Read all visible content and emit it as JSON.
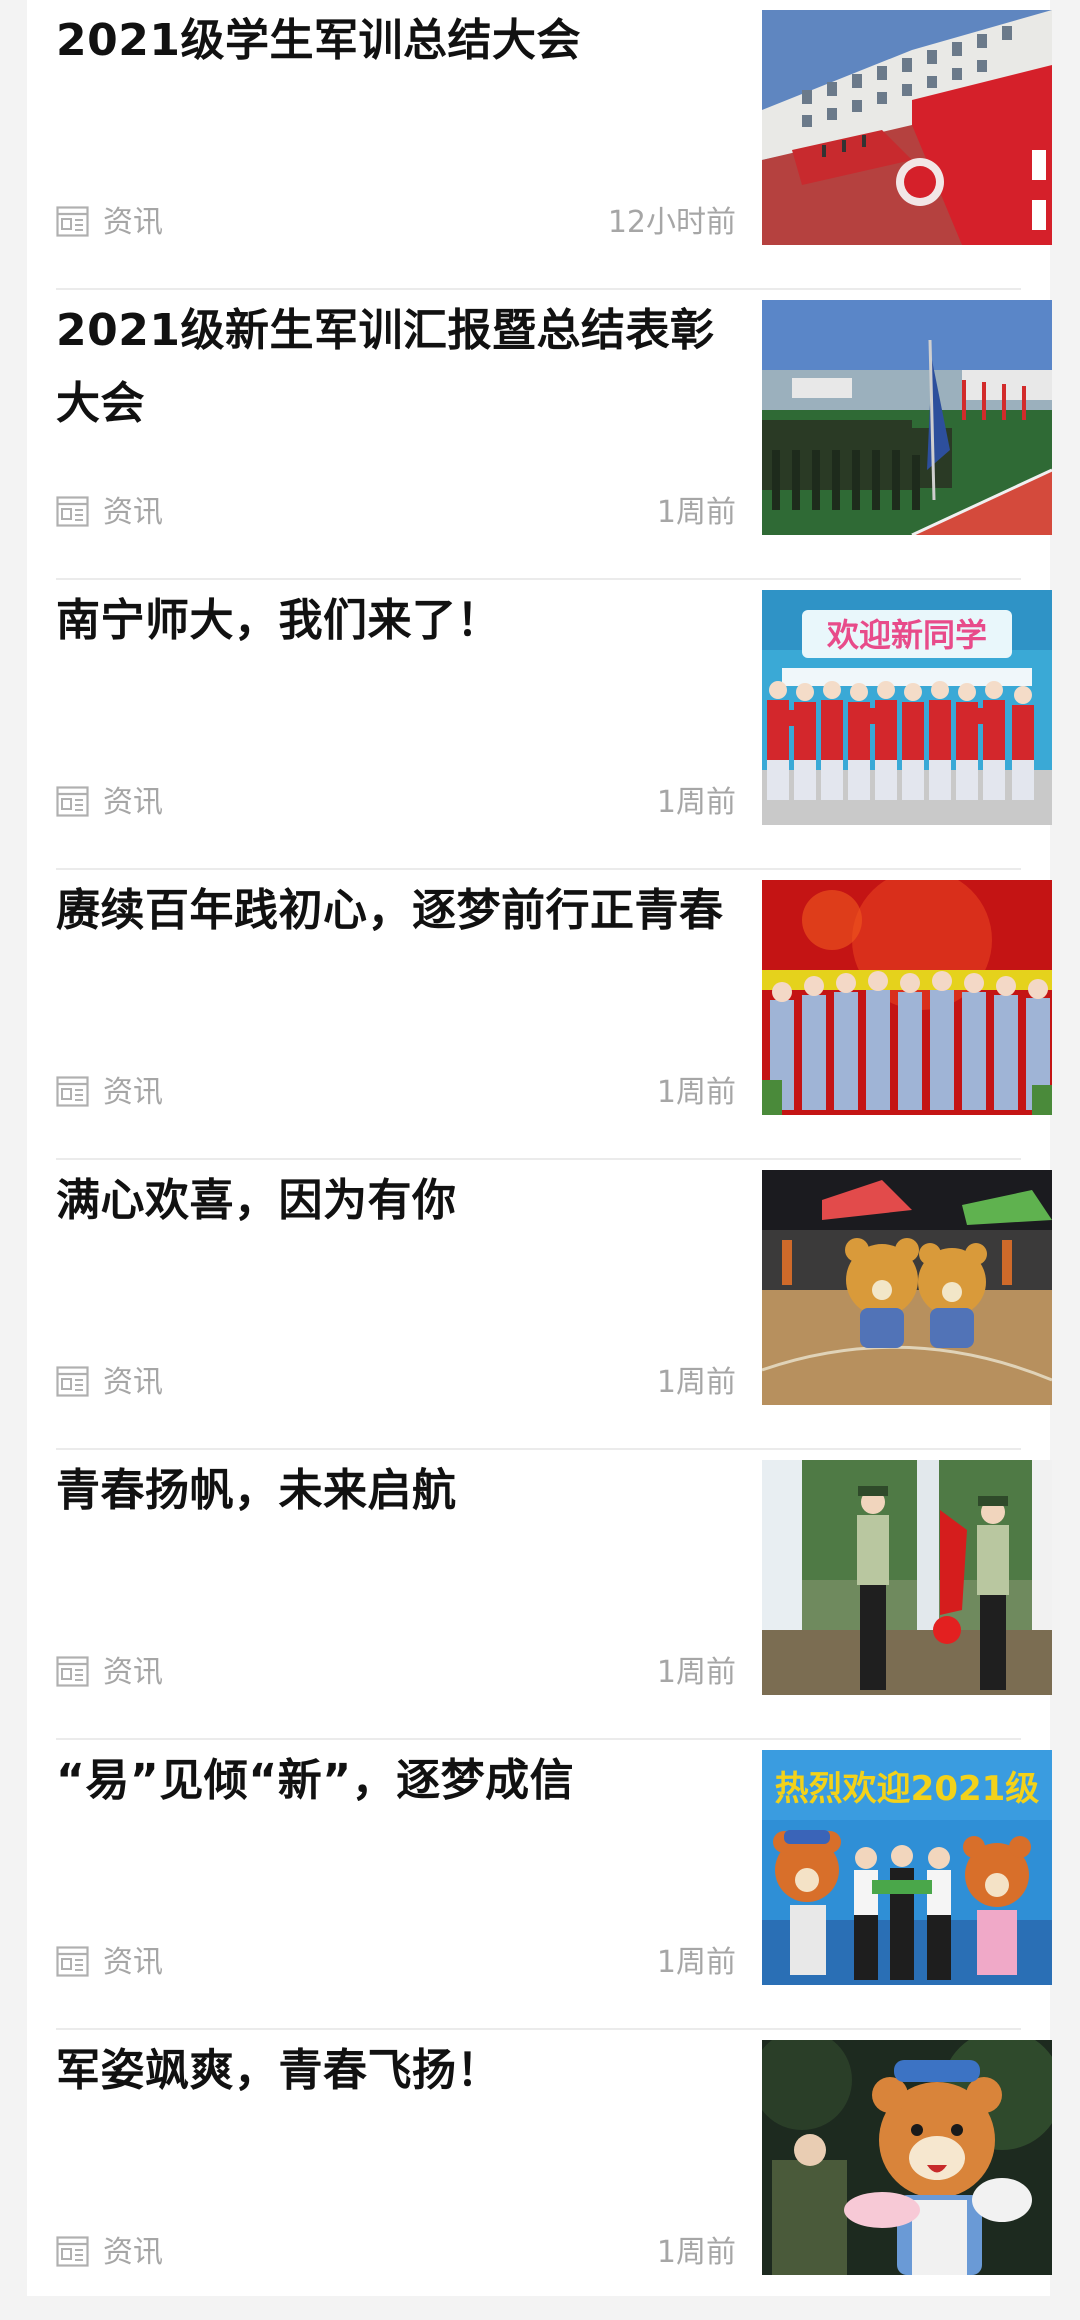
{
  "feed": {
    "items": [
      {
        "title": "2021级学生军训总结大会",
        "category": "资讯",
        "time": "12小时前",
        "icon": "news-icon",
        "thumbnail": "军训总结大会 主席台"
      },
      {
        "title": "2021级新生军训汇报暨总结表彰大会",
        "category": "资讯",
        "time": "1周前",
        "icon": "news-icon",
        "thumbnail": "方阵 旗帜"
      },
      {
        "title": "南宁师大，我们来了！",
        "category": "资讯",
        "time": "1周前",
        "icon": "news-icon",
        "thumbnail": "迎新 合影"
      },
      {
        "title": "赓续百年践初心，逐梦前行正青春",
        "category": "资讯",
        "time": "1周前",
        "icon": "news-icon",
        "thumbnail": "舞台 表演"
      },
      {
        "title": "满心欢喜，因为有你",
        "category": "资讯",
        "time": "1周前",
        "icon": "news-icon",
        "thumbnail": "吉祥物 夜景"
      },
      {
        "title": "青春扬帆，未来启航",
        "category": "资讯",
        "time": "1周前",
        "icon": "news-icon",
        "thumbnail": "升旗仪式"
      },
      {
        "title": "“易”见倾“新”，逐梦成信",
        "category": "资讯",
        "time": "1周前",
        "icon": "news-icon",
        "thumbnail": "热烈欢迎2021级 吉祥物"
      },
      {
        "title": "军姿飒爽，青春飞扬！",
        "category": "资讯",
        "time": "1周前",
        "icon": "news-icon",
        "thumbnail": "吉祥物 合影"
      }
    ],
    "thumb_banner_text": "热烈欢迎2021级",
    "thumb_sign_text": "欢迎新同学"
  },
  "colors": {
    "title": "#111111",
    "meta": "#a6a6a6",
    "divider": "#ebebeb",
    "page_bg": "#f3f3f3",
    "card_bg": "#ffffff"
  }
}
